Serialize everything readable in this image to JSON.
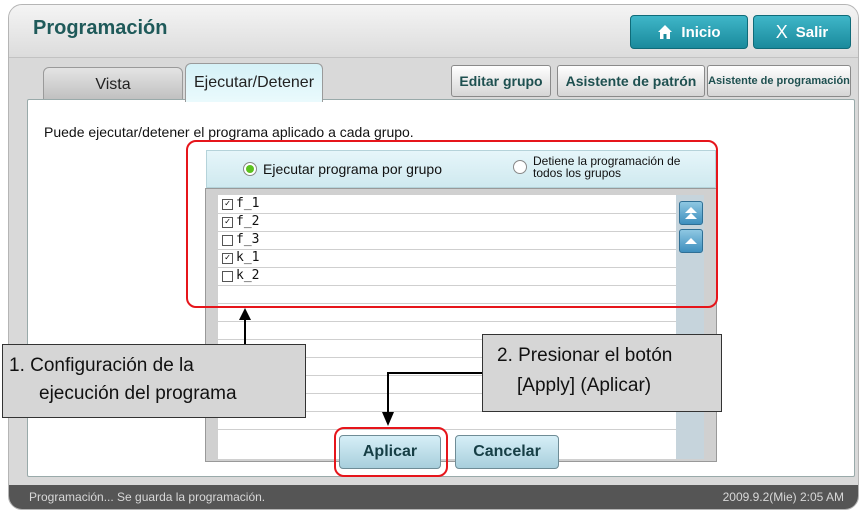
{
  "header": {
    "title": "Programación",
    "home_label": "Inicio",
    "exit_label": "Salir"
  },
  "tabs": [
    {
      "label": "Vista",
      "active": false
    },
    {
      "label": "Ejecutar/Detener",
      "active": true
    }
  ],
  "toolbar": {
    "edit_group": "Editar grupo",
    "pattern_wizard": "Asistente de patrón",
    "schedule_wizard": "Asistente de programación"
  },
  "main": {
    "description": "Puede ejecutar/detener el programa aplicado a cada grupo.",
    "radio_run_by_group": "Ejecutar programa por grupo",
    "radio_stop_all_line1": "Detiene la programación de",
    "radio_stop_all_line2": "todos los grupos",
    "selected_radio": "run_by_group",
    "groups": [
      {
        "name": "f_1",
        "checked": true
      },
      {
        "name": "f_2",
        "checked": true
      },
      {
        "name": "f_3",
        "checked": false
      },
      {
        "name": "k_1",
        "checked": true
      },
      {
        "name": "k_2",
        "checked": false
      }
    ]
  },
  "buttons": {
    "apply": "Aplicar",
    "cancel": "Cancelar"
  },
  "status": {
    "message": "Programación... Se guarda la programación.",
    "datetime": "2009.9.2(Mie) 2:05 AM"
  },
  "annotations": {
    "step1_line1": "1. Configuración de la",
    "step1_line2": "ejecución del programa",
    "step2_line1": "2. Presionar el botón",
    "step2_line2": "[Apply] (Aplicar)"
  },
  "colors": {
    "accent": "#1a8a9c",
    "highlight": "#e6151b",
    "radio_on": "#5cc21f"
  }
}
